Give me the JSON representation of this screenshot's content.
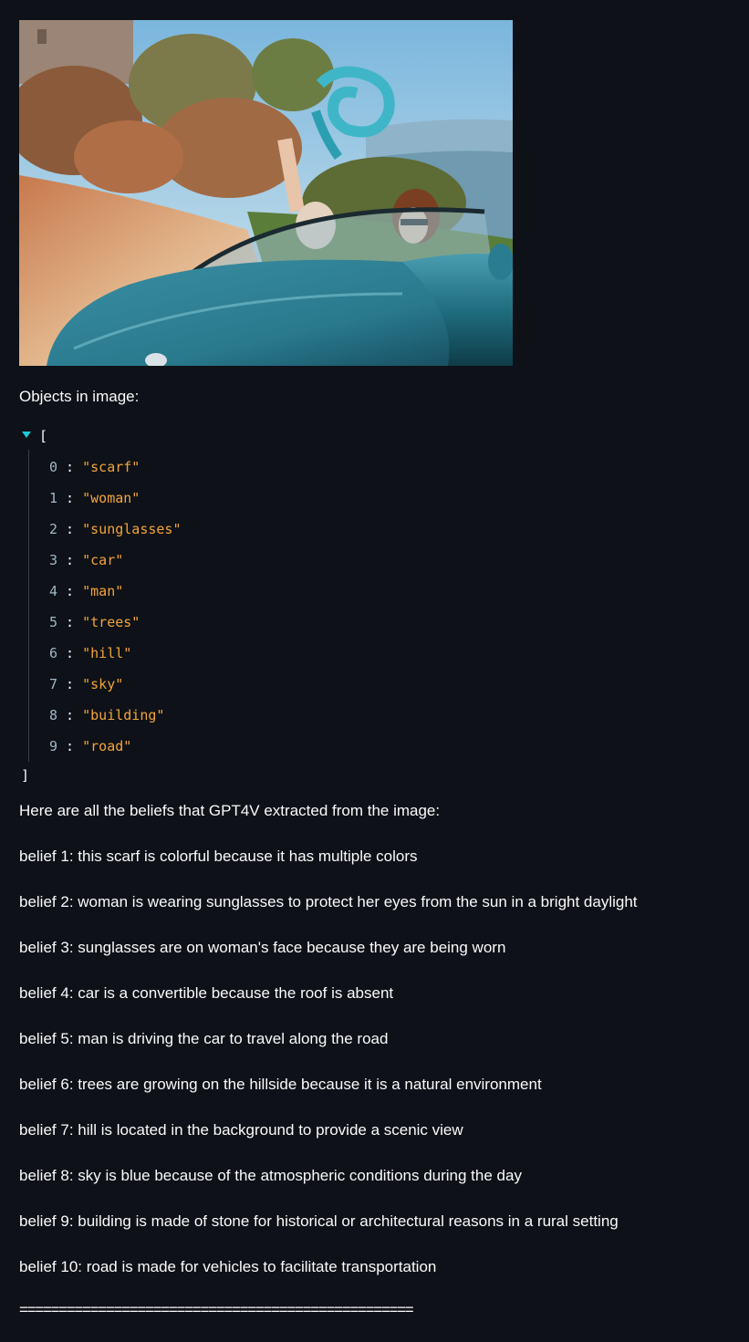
{
  "objects_label": "Objects in image:",
  "objects": {
    "open_bracket": "[",
    "close_bracket": "]",
    "items": [
      {
        "index": "0",
        "value": "\"scarf\""
      },
      {
        "index": "1",
        "value": "\"woman\""
      },
      {
        "index": "2",
        "value": "\"sunglasses\""
      },
      {
        "index": "3",
        "value": "\"car\""
      },
      {
        "index": "4",
        "value": "\"man\""
      },
      {
        "index": "5",
        "value": "\"trees\""
      },
      {
        "index": "6",
        "value": "\"hill\""
      },
      {
        "index": "7",
        "value": "\"sky\""
      },
      {
        "index": "8",
        "value": "\"building\""
      },
      {
        "index": "9",
        "value": "\"road\""
      }
    ]
  },
  "beliefs_intro": "Here are all the beliefs that GPT4V extracted from the image:",
  "beliefs": [
    "belief 1: this scarf is colorful because it has multiple colors",
    "belief 2: woman is wearing sunglasses to protect her eyes from the sun in a bright daylight",
    "belief 3: sunglasses are on woman's face because they are being worn",
    "belief 4: car is a convertible because the roof is absent",
    "belief 5: man is driving the car to travel along the road",
    "belief 6: trees are growing on the hillside because it is a natural environment",
    "belief 7: hill is located in the background to provide a scenic view",
    "belief 8: sky is blue because of the atmospheric conditions during the day",
    "belief 9: building is made of stone for historical or architectural reasons in a rural setting",
    "belief 10: road is made for vehicles to facilitate transportation"
  ],
  "separator": "==================================================",
  "colors": {
    "background": "#0e1117",
    "text": "#fafafa",
    "json_index": "#9fb8c8",
    "json_string": "#f2a43a",
    "toggle": "#1fc9d8"
  }
}
